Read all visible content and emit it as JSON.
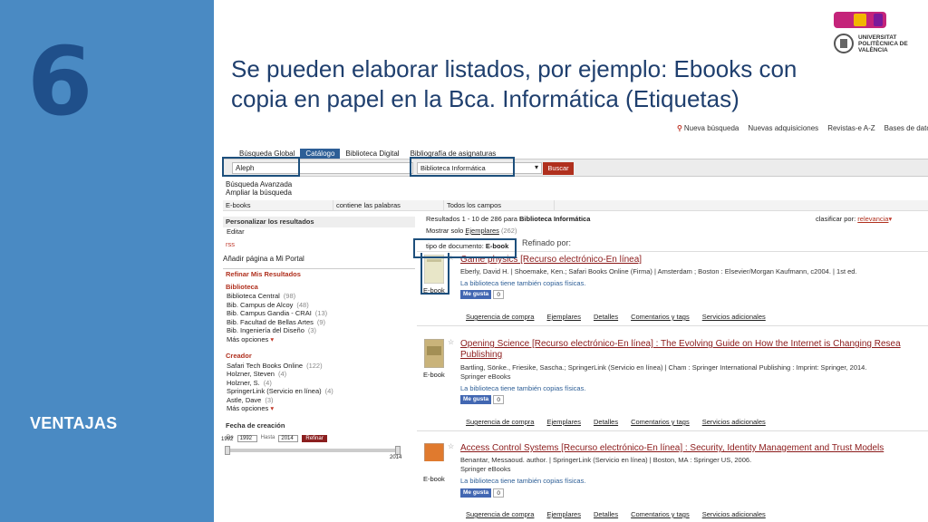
{
  "slide": {
    "number": "6",
    "title": "Se pueden elaborar listados, por ejemplo: Ebooks con copia en papel en la Bca. Informática (Etiquetas)",
    "side_label": "VENTAJAS",
    "logo_upv": "UNIVERSITAT POLITÈCNICA DE VALÈNCIA",
    "colors": {
      "band": "#4a8ac3",
      "number": "#1f4f8a",
      "title": "#1f3f6e",
      "highlight": "#1d4f7c"
    }
  },
  "topnav": {
    "items": [
      "Nueva búsqueda",
      "Nuevas adquisiciones",
      "Revistas-e A-Z",
      "Bases de dato"
    ]
  },
  "tabs": [
    "Búsqueda Global",
    "Catálogo",
    "Biblioteca Digital",
    "Bibliografía de asignaturas"
  ],
  "search": {
    "query": "Aleph",
    "library": "Biblioteca Informática",
    "button": "Buscar"
  },
  "advanced": {
    "adv": "Búsqueda Avanzada",
    "expand": "Ampliar la búsqueda"
  },
  "filters": [
    "E-books",
    "contiene las palabras",
    "Todos los campos"
  ],
  "left": {
    "personalize": "Personalizar los resultados",
    "edit": "Editar",
    "rss": "rss",
    "portal": "Añadir página a Mi Portal",
    "refine": "Refinar Mis Resultados",
    "library_h": "Biblioteca",
    "libraries": [
      {
        "name": "Biblioteca Central",
        "count": "(98)"
      },
      {
        "name": "Bib. Campus de Alcoy",
        "count": "(48)"
      },
      {
        "name": "Bib. Campus Gandia - CRAI",
        "count": "(13)"
      },
      {
        "name": "Bib. Facultad de Bellas Artes",
        "count": "(9)"
      },
      {
        "name": "Bib. Ingeniería del Diseño",
        "count": "(3)"
      }
    ],
    "more": "Más opciones",
    "creator_h": "Creador",
    "creators": [
      {
        "name": "Safari Tech Books Online",
        "count": "(122)"
      },
      {
        "name": "Holzner, Steven",
        "count": "(4)"
      },
      {
        "name": "Holzner, S.",
        "count": "(4)"
      },
      {
        "name": "SpringerLink (Servicio en línea)",
        "count": "(4)"
      },
      {
        "name": "Astle, Dave",
        "count": "(3)"
      }
    ],
    "more2": "Más opciones",
    "date_h": "Fecha de creación",
    "date_de": "De",
    "date_hasta": "Hasta",
    "date_from": "1992",
    "date_to": "2014",
    "date_btn": "Refinar",
    "slider_min": "1992",
    "slider_max": "2014"
  },
  "results": {
    "range": "Resultados 1 - 10 de 286",
    "para": "para",
    "library": "Biblioteca Informática",
    "sort_label": "clasificar por:",
    "sort_value": "relevancia",
    "show_only": "Mostrar solo",
    "copies": "Ejemplares",
    "copies_count": "(262)",
    "doc_type": "tipo de documento:",
    "doc_value": "E-book",
    "refined": "Refinado por:",
    "records": [
      {
        "title": "Game physics [Recurso electrónico-En línea]",
        "authors": "Eberly, David H. | Shoemake, Ken.; Safari Books Online (Firma) | Amsterdam ; Boston : Elsevier/Morgan Kaufmann, c2004. | 1st ed.",
        "extra": "",
        "copies_note": "La biblioteca tiene también copias físicas.",
        "like": "Me gusta",
        "likes": "0",
        "format": "E-book",
        "links": [
          "Sugerencia de compra",
          "Ejemplares",
          "Detalles",
          "Comentarios y tags",
          "Servicios adicionales"
        ],
        "thumb_color": "#e8e6c8"
      },
      {
        "title": "Opening Science [Recurso electrónico-En línea] : The Evolving Guide on How the Internet is Changing Resea Publishing",
        "authors": "Bartling, Sönke., Friesike, Sascha.; SpringerLink (Servicio en línea) | Cham : Springer International Publishing : Imprint: Springer, 2014.",
        "extra": "Springer eBooks",
        "copies_note": "La biblioteca tiene también copias físicas.",
        "like": "Me gusta",
        "likes": "0",
        "format": "E-book",
        "links": [
          "Sugerencia de compra",
          "Ejemplares",
          "Detalles",
          "Comentarios y tags",
          "Servicios adicionales"
        ],
        "thumb_color": "#c9b37a"
      },
      {
        "title": "Access Control Systems [Recurso electrónico-En línea] : Security, Identity Management and Trust Models",
        "authors": "Benantar, Messaoud. author. | SpringerLink (Servicio en línea) | Boston, MA : Springer US, 2006.",
        "extra": "Springer eBooks",
        "copies_note": "La biblioteca tiene también copias físicas.",
        "like": "Me gusta",
        "likes": "0",
        "format": "E-book",
        "links": [
          "Sugerencia de compra",
          "Ejemplares",
          "Detalles",
          "Comentarios y tags",
          "Servicios adicionales"
        ],
        "thumb_color": "#e07a2e"
      }
    ]
  }
}
